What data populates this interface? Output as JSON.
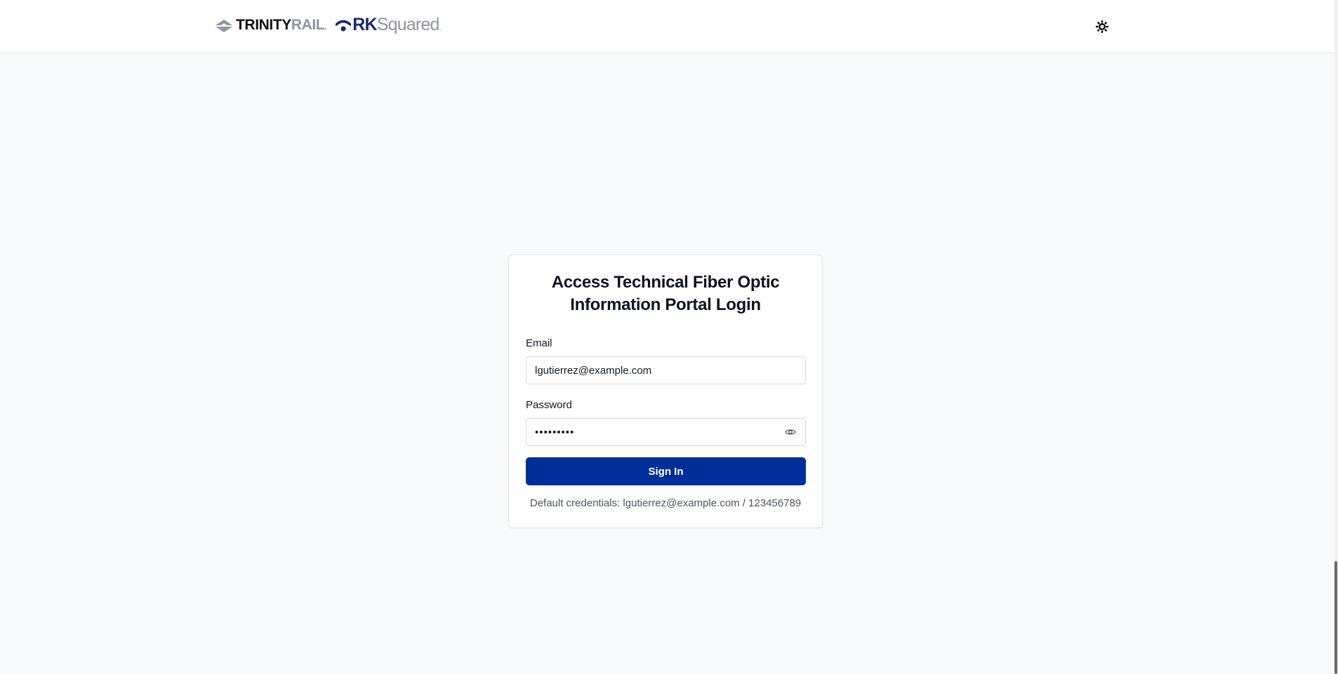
{
  "header": {
    "trinity_logo": {
      "word1": "TRINITY",
      "word2": "RAIL",
      "mark": "."
    },
    "rk_logo": {
      "word1": "RK",
      "word2": "Squared",
      "mark": "."
    },
    "theme_toggle_icon": "sun-icon"
  },
  "login": {
    "title": "Access Technical Fiber Optic Information Portal Login",
    "email_label": "Email",
    "email_value": "lgutierrez@example.com",
    "password_label": "Password",
    "password_value": "123456789",
    "password_toggle_icon": "eye-icon",
    "submit_label": "Sign In",
    "default_credentials": "Default credentials: lgutierrez@example.com / 123456789"
  },
  "colors": {
    "primary": "#002e99",
    "page_background": "#f8f9fa",
    "rk_navy": "#1b2a6b",
    "logo_gray": "#8a96a3"
  }
}
